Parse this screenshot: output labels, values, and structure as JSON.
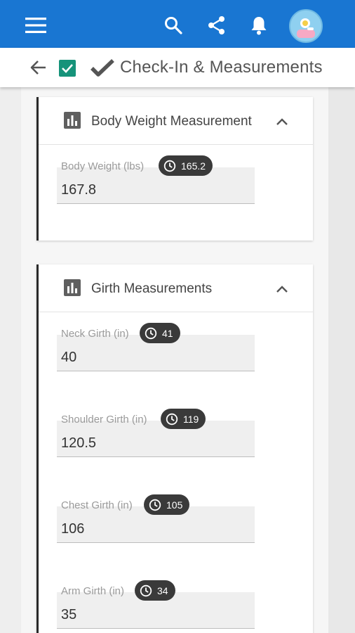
{
  "app": {
    "title": "Check-In & Measurements",
    "accent": "#1976d2",
    "icons": [
      "menu-icon",
      "search-icon",
      "share-icon",
      "bell-icon",
      "avatar"
    ]
  },
  "sections": [
    {
      "title": "Body Weight Measurement",
      "icon": "bar-chart-icon",
      "fields": [
        {
          "label": "Body Weight (lbs)",
          "value": "167.8",
          "previous": "165.2"
        }
      ]
    },
    {
      "title": "Girth Measurements",
      "icon": "bar-chart-icon",
      "fields": [
        {
          "label": "Neck Girth (in)",
          "value": "40",
          "previous": "41"
        },
        {
          "label": "Shoulder Girth (in)",
          "value": "120.5",
          "previous": "119"
        },
        {
          "label": "Chest Girth (in)",
          "value": "106",
          "previous": "105"
        },
        {
          "label": "Arm Girth (in)",
          "value": "35",
          "previous": "34"
        }
      ]
    }
  ]
}
